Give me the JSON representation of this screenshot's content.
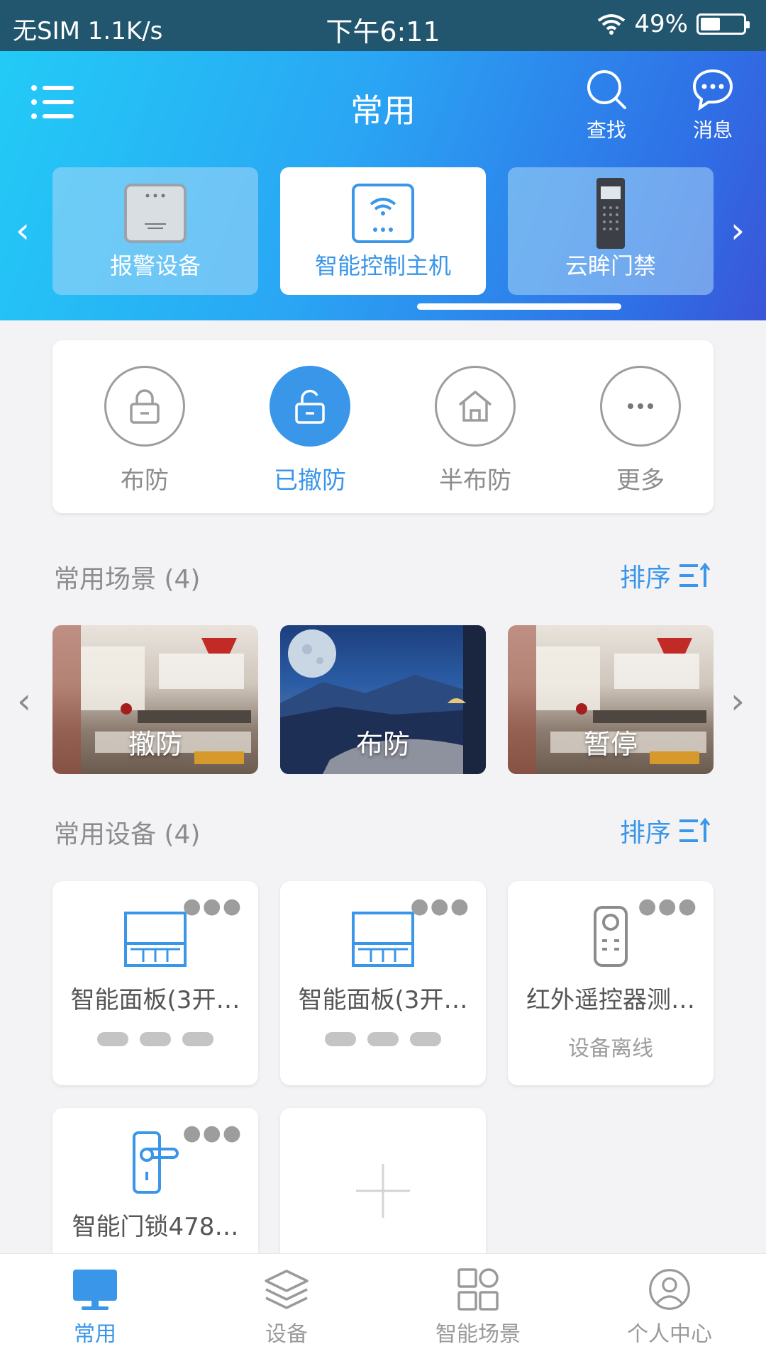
{
  "status_bar": {
    "carrier": "无SIM 1.1K/s",
    "time": "下午6:11",
    "battery": "49%"
  },
  "header": {
    "title": "常用",
    "search_label": "查找",
    "messages_label": "消息"
  },
  "device_carousel": [
    {
      "label": "报警设备",
      "icon": "alarm-panel-icon",
      "active": false
    },
    {
      "label": "智能控制主机",
      "icon": "control-host-icon",
      "active": true
    },
    {
      "label": "云眸门禁",
      "icon": "door-access-icon",
      "active": false
    }
  ],
  "modes": [
    {
      "label": "布防",
      "icon": "lock-icon"
    },
    {
      "label": "已撤防",
      "icon": "unlock-icon",
      "active": true
    },
    {
      "label": "半布防",
      "icon": "home-icon"
    },
    {
      "label": "更多",
      "icon": "more-icon"
    }
  ],
  "scenes_section": {
    "title": "常用场景 (4)",
    "sort_label": "排序"
  },
  "scenes": [
    {
      "label": "撤防"
    },
    {
      "label": "布防"
    },
    {
      "label": "暂停"
    }
  ],
  "devices_section": {
    "title": "常用设备 (4)",
    "sort_label": "排序"
  },
  "devices": [
    {
      "name": "智能面板(3开…",
      "icon": "smart-panel-icon"
    },
    {
      "name": "智能面板(3开…",
      "icon": "smart-panel-icon"
    },
    {
      "name": "红外遥控器测…",
      "icon": "remote-control-icon",
      "status": "设备离线"
    },
    {
      "name": "智能门锁478…",
      "icon": "door-lock-icon"
    }
  ],
  "bottom_nav": [
    {
      "label": "常用",
      "active": true
    },
    {
      "label": "设备"
    },
    {
      "label": "智能场景"
    },
    {
      "label": "个人中心"
    }
  ],
  "colors": {
    "accent": "#3a96e8",
    "header_gradient_start": "#22cdf6",
    "header_gradient_end": "#3a55d8"
  }
}
